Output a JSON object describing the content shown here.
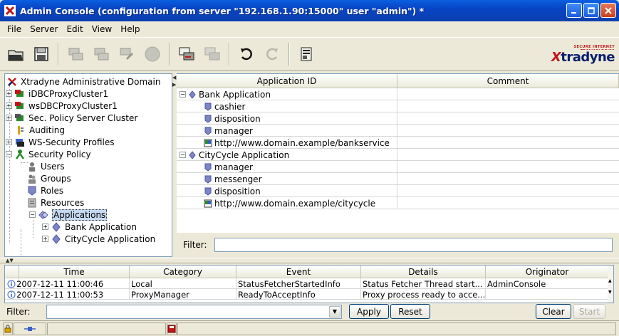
{
  "window": {
    "title": "Admin Console (configuration from server \"192.168.1.90:15000\" user \"admin\") *"
  },
  "menu": [
    "File",
    "Server",
    "Edit",
    "View",
    "Help"
  ],
  "toolbar": {
    "icons": [
      "open-folder-icon",
      "save-icon",
      "server-add-icon",
      "server-remove-icon",
      "server-edit-icon",
      "stop-icon",
      "deploy-icon",
      "undeploy-icon",
      "undo-icon",
      "redo-icon",
      "settings-icon"
    ],
    "brand_tagline": "SECURE INTERNET TECHNOLOGIES",
    "brand_name_prefix": "X",
    "brand_name_rest": "tradyne"
  },
  "tree": {
    "items": [
      {
        "label": "Xtradyne Administrative Domain",
        "icon": "domain-icon"
      },
      {
        "label": "iDBCProxyCluster1",
        "icon": "cluster-icon"
      },
      {
        "label": "wsDBCProxyCluster1",
        "icon": "cluster-icon"
      },
      {
        "label": "Sec. Policy Server Cluster",
        "icon": "cluster-icon"
      },
      {
        "label": "Auditing",
        "icon": "auditing-icon"
      },
      {
        "label": "WS-Security Profiles",
        "icon": "profiles-icon"
      },
      {
        "label": "Security Policy",
        "icon": "policy-icon"
      },
      {
        "label": "Users",
        "icon": "user-icon"
      },
      {
        "label": "Groups",
        "icon": "group-icon"
      },
      {
        "label": "Roles",
        "icon": "role-icon"
      },
      {
        "label": "Resources",
        "icon": "resource-icon"
      },
      {
        "label": "Applications",
        "icon": "applications-icon"
      },
      {
        "label": "Bank Application",
        "icon": "application-icon"
      },
      {
        "label": "CityCycle Application",
        "icon": "application-icon"
      }
    ]
  },
  "app_table": {
    "columns": [
      "Application ID",
      "Comment"
    ],
    "rows": [
      {
        "label": "Bank Application",
        "kind": "group",
        "comment": ""
      },
      {
        "label": "cashier",
        "kind": "role",
        "comment": ""
      },
      {
        "label": "disposition",
        "kind": "role",
        "comment": ""
      },
      {
        "label": "manager",
        "kind": "role",
        "comment": ""
      },
      {
        "label": "http://www.domain.example/bankservice",
        "kind": "url",
        "comment": ""
      },
      {
        "label": "CityCycle Application",
        "kind": "group",
        "comment": ""
      },
      {
        "label": "manager",
        "kind": "role",
        "comment": ""
      },
      {
        "label": "messenger",
        "kind": "role",
        "comment": ""
      },
      {
        "label": "disposition",
        "kind": "role",
        "comment": ""
      },
      {
        "label": "http://www.domain.example/citycycle",
        "kind": "url",
        "comment": ""
      }
    ],
    "filter_label": "Filter:",
    "filter_value": ""
  },
  "log_table": {
    "columns": [
      "Time",
      "Category",
      "Event",
      "Details",
      "Originator"
    ],
    "rows": [
      {
        "time": "2007-12-11 11:00:46",
        "category": "Local",
        "event": "StatusFetcherStartedInfo",
        "details": "Status Fetcher Thread start...",
        "originator": "AdminConsole"
      },
      {
        "time": "2007-12-11 11:00:53",
        "category": "ProxyManager",
        "event": "ReadyToAcceptInfo",
        "details": "Proxy process ready to acce...",
        "originator": ""
      }
    ]
  },
  "log_controls": {
    "filter_label": "Filter:",
    "filter_value": "",
    "apply_label": "Apply",
    "reset_label": "Reset",
    "clear_label": "Clear",
    "start_label": "Start"
  },
  "statusbar": {
    "icons": [
      "lock-icon",
      "connection-icon",
      "save-state-icon"
    ]
  }
}
